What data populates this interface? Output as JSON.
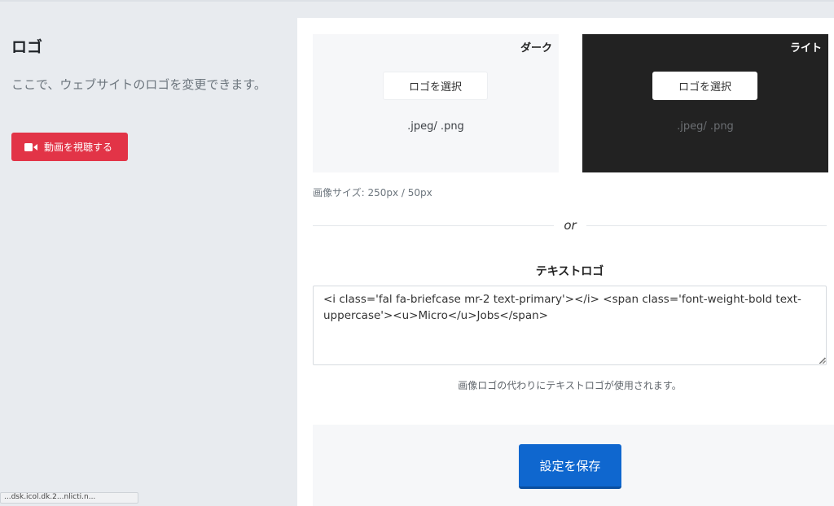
{
  "left": {
    "title": "ロゴ",
    "description": "ここで、ウェブサイトのロゴを変更できます。",
    "video_button": {
      "label": "動画を視聴する",
      "icon": "video-camera-icon",
      "color": "#e23447"
    }
  },
  "logos": {
    "dark": {
      "label": "ダーク",
      "select_label": "ロゴを選択",
      "ext": ".jpeg/ .png"
    },
    "light": {
      "label": "ライト",
      "select_label": "ロゴを選択",
      "ext": ".jpeg/ .png"
    }
  },
  "size_note": "画像サイズ: 250px / 50px",
  "divider_text": "or",
  "text_logo": {
    "title": "テキストロゴ",
    "value": "<i class='fal fa-briefcase mr-2 text-primary'></i> <span class='font-weight-bold text-uppercase'><u>Micro</u>Jobs</span>",
    "help": "画像ロゴの代わりにテキストロゴが使用されます。"
  },
  "save_button": {
    "label": "設定を保存",
    "color": "#0f67cf"
  },
  "bottom_tip": "...dsk.icol.dk.2...nlicti.n..."
}
